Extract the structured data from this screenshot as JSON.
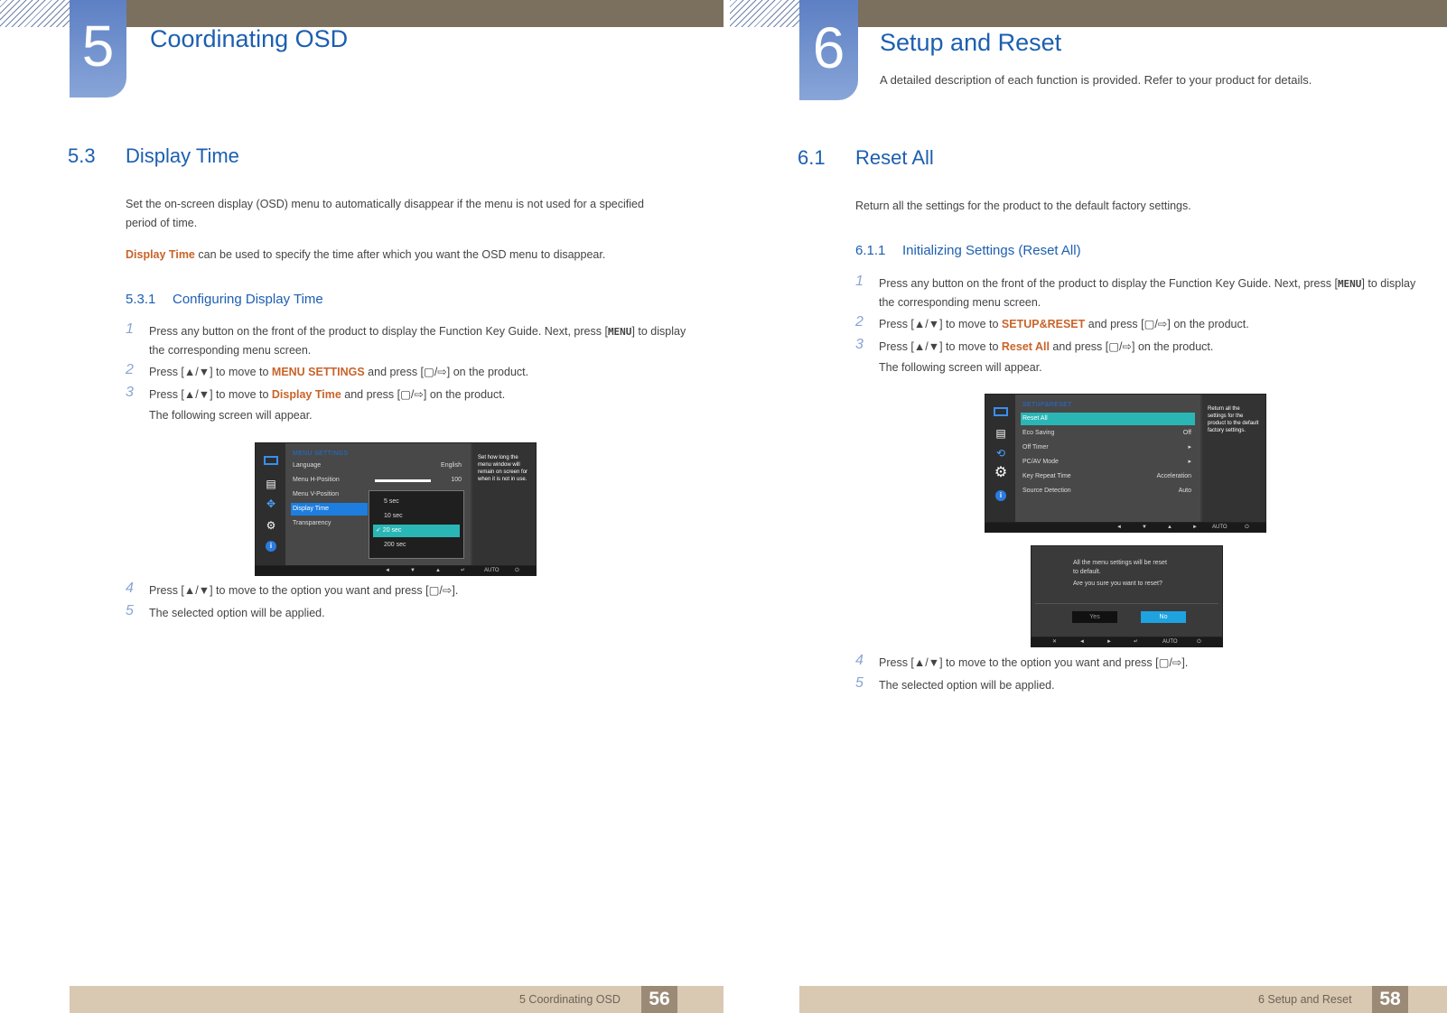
{
  "left": {
    "chapter_number": "5",
    "chapter_title": "Coordinating OSD",
    "section_number": "5.3",
    "section_title": "Display Time",
    "intro_1": "Set the on-screen display (OSD) menu to automatically disappear if the menu is not used for a specified period of time.",
    "intro_2_highlight": "Display Time",
    "intro_2_rest": " can be used to specify the time after which you want the OSD menu to disappear.",
    "subsection_number": "5.3.1",
    "subsection_title": "Configuring Display Time",
    "steps": [
      {
        "n": "1",
        "a": "Press any button on the front of the product to display the Function Key Guide. Next, press [",
        "key": "MENU",
        "b": "] to display the corresponding menu screen."
      },
      {
        "n": "2",
        "a": "Press [▲/▼] to move to ",
        "hl": "MENU SETTINGS",
        "b": " and press [▢/⇨] on the product."
      },
      {
        "n": "3",
        "a": "Press [▲/▼] to move to ",
        "hl": "Display Time",
        "b": " and press [▢/⇨] on the product.",
        "c": "The following screen will appear."
      },
      {
        "n": "4",
        "a": "Press [▲/▼] to move to the option you want and press [▢/⇨]."
      },
      {
        "n": "5",
        "a": "The selected option will be applied."
      }
    ],
    "osd": {
      "heading": "MENU SETTINGS",
      "rows": [
        {
          "label": "Language",
          "value": "English"
        },
        {
          "label": "Menu H-Position",
          "value": "100"
        },
        {
          "label": "Menu V-Position",
          "value": ""
        },
        {
          "label": "Display Time",
          "value": ""
        },
        {
          "label": "Transparency",
          "value": ""
        }
      ],
      "popup": [
        "5 sec",
        "10 sec",
        "✓ 20 sec",
        "200 sec"
      ],
      "help": "Set how long the menu window will remain on screen for when it is not in use.",
      "bar": [
        "◄",
        "▼",
        "▲",
        "↵",
        "AUTO",
        "⏻"
      ]
    },
    "footer_label": "5 Coordinating OSD",
    "page_number": "56"
  },
  "right": {
    "chapter_number": "6",
    "chapter_title": "Setup and Reset",
    "chapter_desc": "A detailed description of each function is provided. Refer to your product for details.",
    "section_number": "6.1",
    "section_title": "Reset All",
    "intro": "Return all the settings for the product to the default factory settings.",
    "subsection_number": "6.1.1",
    "subsection_title": "Initializing Settings (Reset All)",
    "steps": [
      {
        "n": "1",
        "a": "Press any button on the front of the product to display the Function Key Guide. Next, press [",
        "key": "MENU",
        "b": "] to display the corresponding menu screen."
      },
      {
        "n": "2",
        "a": "Press [▲/▼] to move to ",
        "hl": "SETUP&RESET",
        "b": " and press [▢/⇨] on the product."
      },
      {
        "n": "3",
        "a": "Press [▲/▼] to move to ",
        "hl": "Reset All",
        "b": " and press [▢/⇨] on the product.",
        "c": "The following screen will appear."
      },
      {
        "n": "4",
        "a": "Press [▲/▼] to move to the option you want and press [▢/⇨]."
      },
      {
        "n": "5",
        "a": "The selected option will be applied."
      }
    ],
    "osd": {
      "heading": "SETUP&RESET",
      "rows": [
        {
          "label": "Reset All",
          "value": ""
        },
        {
          "label": "Eco Saving",
          "value": "Off"
        },
        {
          "label": "Off Timer",
          "value": "▸"
        },
        {
          "label": "PC/AV Mode",
          "value": "▸"
        },
        {
          "label": "Key Repeat Time",
          "value": "Acceleration"
        },
        {
          "label": "Source Detection",
          "value": "Auto"
        }
      ],
      "help": "Return all the settings for the product to the default factory settings.",
      "bar": [
        "◄",
        "▼",
        "▲",
        "►",
        "AUTO",
        "⏻"
      ]
    },
    "dialog": {
      "line1": "All the menu settings will be reset",
      "line2": "to default.",
      "line3": "Are you sure you want to reset?",
      "yes": "Yes",
      "no": "No",
      "bar": [
        "✕",
        "◄",
        "►",
        "↵",
        "AUTO",
        "⏻"
      ]
    },
    "footer_label": "6 Setup and Reset",
    "page_number": "58"
  }
}
